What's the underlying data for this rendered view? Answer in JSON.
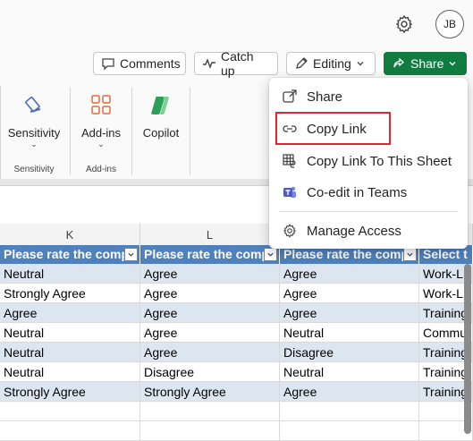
{
  "header": {
    "avatar_initials": "JB",
    "buttons": {
      "comments": "Comments",
      "catch_up": "Catch up",
      "editing": "Editing",
      "share": "Share"
    }
  },
  "ribbon": {
    "groups": [
      {
        "item": "Sensitivity",
        "label": "Sensitivity"
      },
      {
        "item": "Add-ins",
        "label": "Add-ins"
      },
      {
        "item": "Copilot",
        "label": ""
      }
    ]
  },
  "grid": {
    "column_letters": [
      "K",
      "L"
    ],
    "header_cells": [
      "Please rate the comp",
      "Please rate the comp",
      "Please rate the comp",
      "Select t"
    ],
    "rows": [
      [
        "Neutral",
        "Agree",
        "Agree",
        "Work-L"
      ],
      [
        "Strongly Agree",
        "Agree",
        "Agree",
        "Work-L"
      ],
      [
        "Agree",
        "Agree",
        "Agree",
        "Training"
      ],
      [
        "Neutral",
        "Agree",
        "Neutral",
        "Commu"
      ],
      [
        "Neutral",
        "Agree",
        "Disagree",
        "Training"
      ],
      [
        "Neutral",
        "Disagree",
        "Neutral",
        "Training"
      ],
      [
        "Strongly Agree",
        "Strongly Agree",
        "Agree",
        "Training"
      ]
    ]
  },
  "share_menu": {
    "items": [
      {
        "label": "Share",
        "icon": "share-icon"
      },
      {
        "label": "Copy Link",
        "icon": "link-icon"
      },
      {
        "label": "Copy Link To This Sheet",
        "icon": "sheet-link-icon"
      },
      {
        "label": "Co-edit in Teams",
        "icon": "teams-icon"
      },
      {
        "label": "Manage Access",
        "icon": "gear-icon"
      }
    ]
  },
  "colors": {
    "share_green": "#107c41",
    "table_header_blue": "#4f81bd",
    "band_row": "#dce6f1",
    "highlight_red": "#e0262f"
  }
}
